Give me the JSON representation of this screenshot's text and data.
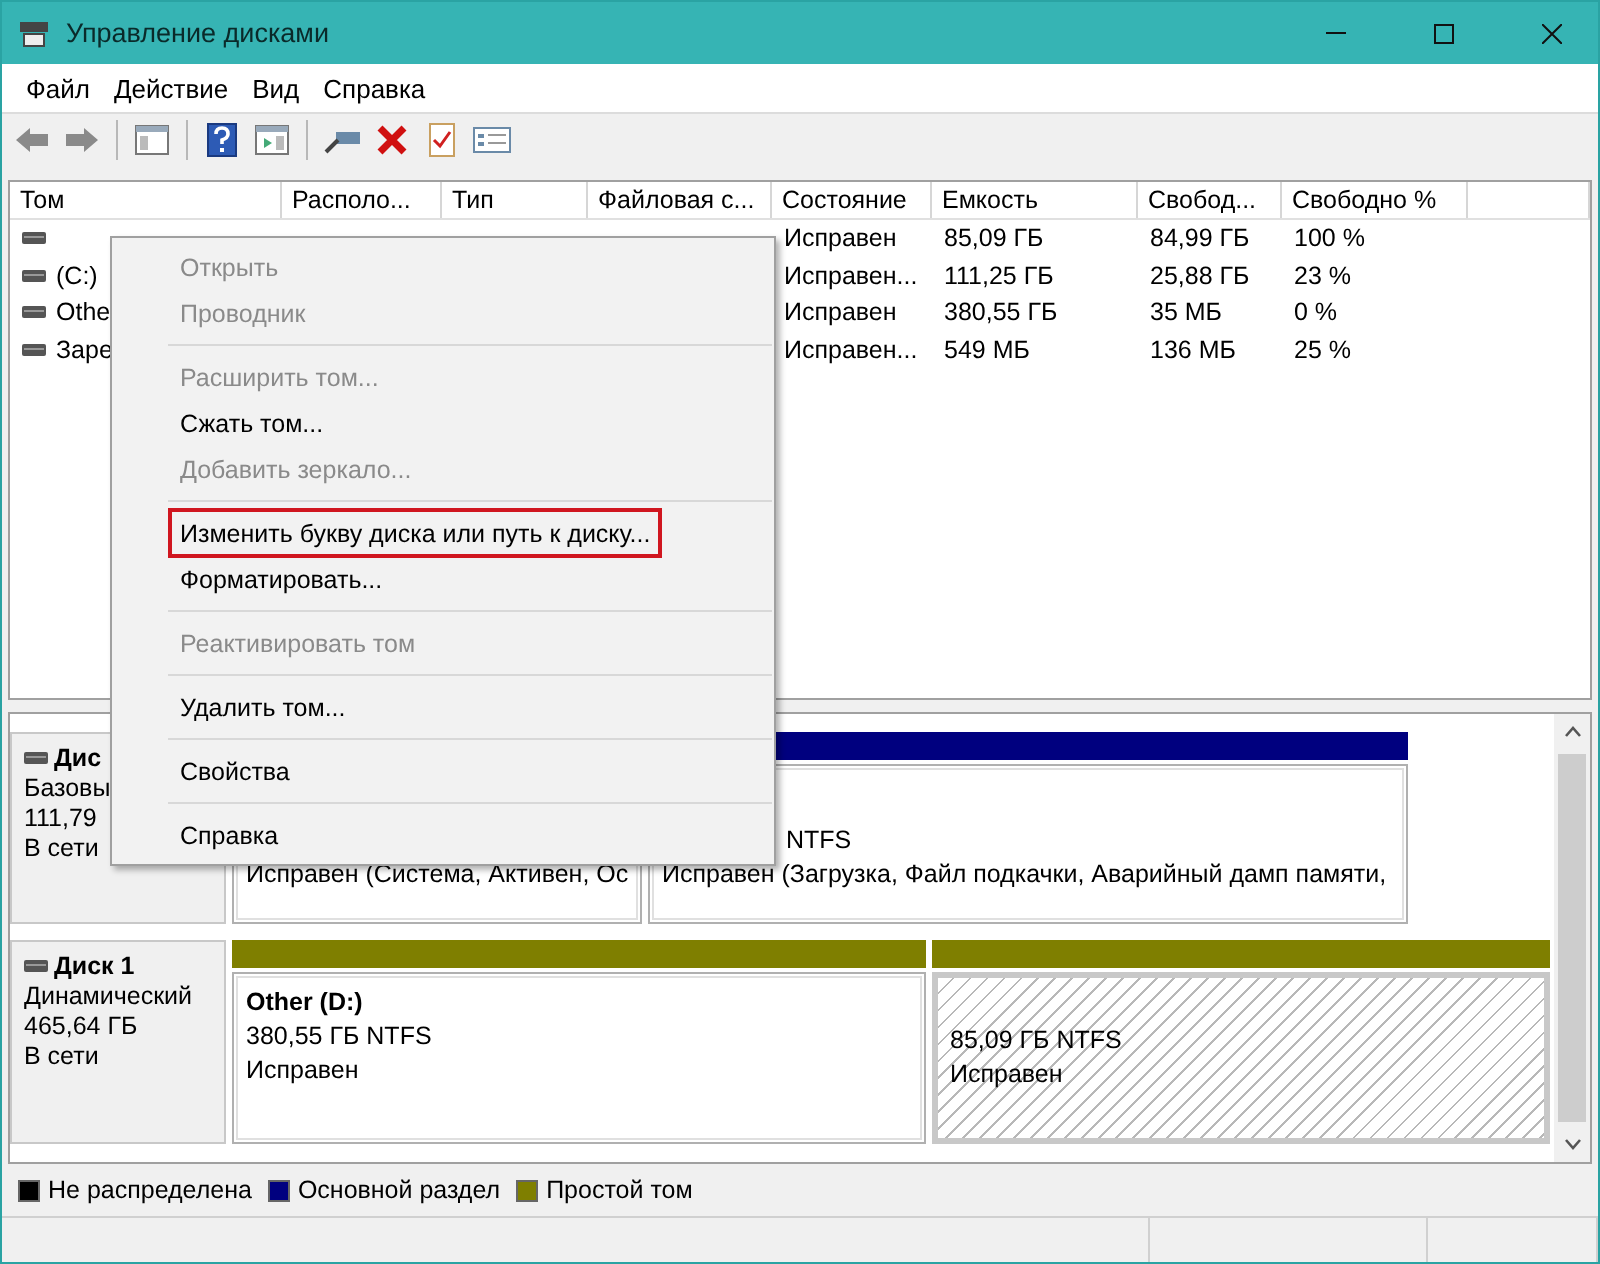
{
  "window": {
    "title": "Управление дисками"
  },
  "menu_bar": [
    "Файл",
    "Действие",
    "Вид",
    "Справка"
  ],
  "toolbar": [
    {
      "kind": "back",
      "disabled": false
    },
    {
      "kind": "forward",
      "disabled": false
    },
    {
      "kind": "separator"
    },
    {
      "kind": "panel"
    },
    {
      "kind": "separator"
    },
    {
      "kind": "help"
    },
    {
      "kind": "panel2"
    },
    {
      "kind": "separator"
    },
    {
      "kind": "connect"
    },
    {
      "kind": "delete"
    },
    {
      "kind": "properties"
    },
    {
      "kind": "list"
    }
  ],
  "table": {
    "columns": [
      "Том",
      "Располо...",
      "Тип",
      "Файловая с...",
      "Состояние",
      "Емкость",
      "Свобод...",
      "Свободно %"
    ],
    "rows": [
      [
        null,
        null,
        null,
        null,
        "Исправен",
        "85,09 ГБ",
        "84,99 ГБ",
        "100 %"
      ],
      [
        "(C:)",
        null,
        null,
        null,
        "Исправен...",
        "111,25 ГБ",
        "25,88 ГБ",
        "23 %"
      ],
      [
        "Othe",
        null,
        null,
        null,
        "Исправен",
        "380,55 ГБ",
        "35 МБ",
        "0 %"
      ],
      [
        "Заре",
        null,
        null,
        null,
        "Исправен...",
        "549 МБ",
        "136 МБ",
        "25 %"
      ]
    ]
  },
  "disks": [
    {
      "name": "Дис",
      "kind_label": "Базовы",
      "size": "111,79",
      "state": "В сети",
      "partitions": [
        {
          "selected": false,
          "lines": [
            {
              "kind": "normal",
              "text": "Исправен (Система, Активен, Ос"
            }
          ]
        },
        {
          "color": "#00007f",
          "selected": false,
          "lines": [
            {
              "kind": "clipped",
              "text": "NTFS"
            },
            {
              "kind": "normal",
              "text": "Исправен (Загрузка, Файл подкачки, Аварийный дамп памяти,"
            }
          ]
        }
      ]
    },
    {
      "name": "Диск 1",
      "kind_label": "Динамический",
      "size": "465,64 ГБ",
      "state": "В сети",
      "partitions": [
        {
          "color": "#7f7f00",
          "selected": false,
          "title": "Other  (D:)",
          "lines": [
            {
              "kind": "normal",
              "text": "380,55 ГБ NTFS"
            },
            {
              "kind": "normal",
              "text": "Исправен"
            }
          ]
        },
        {
          "color": "#7f7f00",
          "selected": true,
          "lines": [
            {
              "kind": "normal",
              "text": "85,09 ГБ NTFS"
            },
            {
              "kind": "normal",
              "text": "Исправен"
            }
          ]
        }
      ]
    }
  ],
  "legend": [
    {
      "label": "Не распределена",
      "color": "#000000"
    },
    {
      "label": "Основной раздел",
      "color": "#00007f"
    },
    {
      "label": "Простой том",
      "color": "#7f7f00"
    }
  ],
  "context_menu": [
    {
      "kind": "item",
      "label": "Открыть",
      "disabled": true,
      "highlighted": false
    },
    {
      "kind": "item",
      "label": "Проводник",
      "disabled": true,
      "highlighted": false
    },
    {
      "kind": "separator"
    },
    {
      "kind": "item",
      "label": "Расширить том...",
      "disabled": true,
      "highlighted": false
    },
    {
      "kind": "item",
      "label": "Сжать том...",
      "disabled": false,
      "highlighted": false
    },
    {
      "kind": "item",
      "label": "Добавить зеркало...",
      "disabled": true,
      "highlighted": false
    },
    {
      "kind": "separator"
    },
    {
      "kind": "item",
      "label": "Изменить букву диска или путь к диску...",
      "disabled": false,
      "highlighted": true
    },
    {
      "kind": "item",
      "label": "Форматировать...",
      "disabled": false,
      "highlighted": false
    },
    {
      "kind": "separator"
    },
    {
      "kind": "item",
      "label": "Реактивировать том",
      "disabled": true,
      "highlighted": false
    },
    {
      "kind": "separator"
    },
    {
      "kind": "item",
      "label": "Удалить том...",
      "disabled": false,
      "highlighted": false
    },
    {
      "kind": "separator"
    },
    {
      "kind": "item",
      "label": "Свойства",
      "disabled": false,
      "highlighted": false
    },
    {
      "kind": "separator"
    },
    {
      "kind": "item",
      "label": "Справка",
      "disabled": false,
      "highlighted": false
    }
  ]
}
